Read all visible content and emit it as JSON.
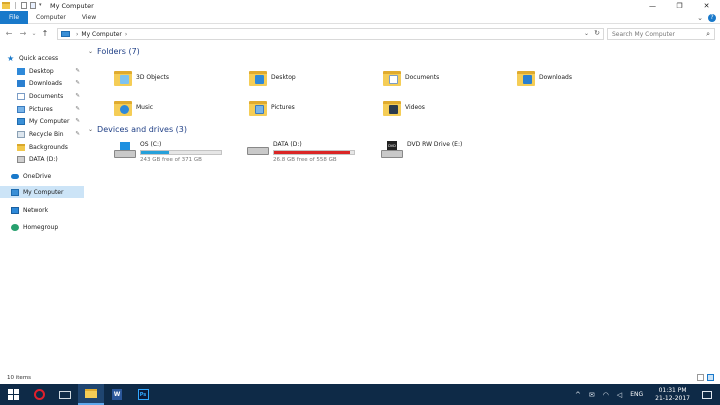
{
  "window": {
    "title": "My Computer",
    "controls": {
      "minimize": "—",
      "maximize": "❐",
      "close": "✕"
    }
  },
  "ribbon": {
    "tabs": [
      {
        "label": "File"
      },
      {
        "label": "Computer"
      },
      {
        "label": "View"
      }
    ],
    "expand": "⌄",
    "help": "?"
  },
  "address": {
    "breadcrumb": [
      "My Computer"
    ],
    "chevron": "›",
    "search_placeholder": "Search My Computer"
  },
  "nav": {
    "back": "←",
    "forward": "→",
    "recent": "⌄",
    "up": "↑"
  },
  "sidebar": {
    "quick_access": "Quick access",
    "items": [
      {
        "label": "Desktop",
        "pinned": true
      },
      {
        "label": "Downloads",
        "pinned": true
      },
      {
        "label": "Documents",
        "pinned": true
      },
      {
        "label": "Pictures",
        "pinned": true
      },
      {
        "label": "My Computer",
        "pinned": true
      },
      {
        "label": "Recycle Bin",
        "pinned": true
      },
      {
        "label": "Backgrounds",
        "pinned": false
      },
      {
        "label": "DATA (D:)",
        "pinned": false
      }
    ],
    "onedrive": "OneDrive",
    "my_computer": "My Computer",
    "network": "Network",
    "homegroup": "Homegroup",
    "pin_glyph": "📌"
  },
  "main": {
    "folders_header": "Folders (7)",
    "folders": [
      {
        "label": "3D Objects"
      },
      {
        "label": "Desktop"
      },
      {
        "label": "Documents"
      },
      {
        "label": "Downloads"
      },
      {
        "label": "Music"
      },
      {
        "label": "Pictures"
      },
      {
        "label": "Videos"
      }
    ],
    "drives_header": "Devices and drives (3)",
    "drives": [
      {
        "label": "OS (C:)",
        "free": "243 GB free of 371 GB",
        "used_fraction": 0.345,
        "color": "#26a0da"
      },
      {
        "label": "DATA (D:)",
        "free": "26.8 GB free of 558 GB",
        "used_fraction": 0.952,
        "color": "#da2626"
      },
      {
        "label": "DVD RW Drive (E:)"
      }
    ]
  },
  "status": {
    "items": "10 items"
  },
  "taskbar": {
    "word_letter": "W",
    "ps_letters": "Ps",
    "tray": {
      "chevron": "^",
      "lang": "ENG",
      "time": "01:31 PM",
      "date": "21-12-2017"
    }
  },
  "colors": {
    "accent": "#1979ca",
    "taskbar": "#0e2a47",
    "selection": "#cce4f7"
  }
}
